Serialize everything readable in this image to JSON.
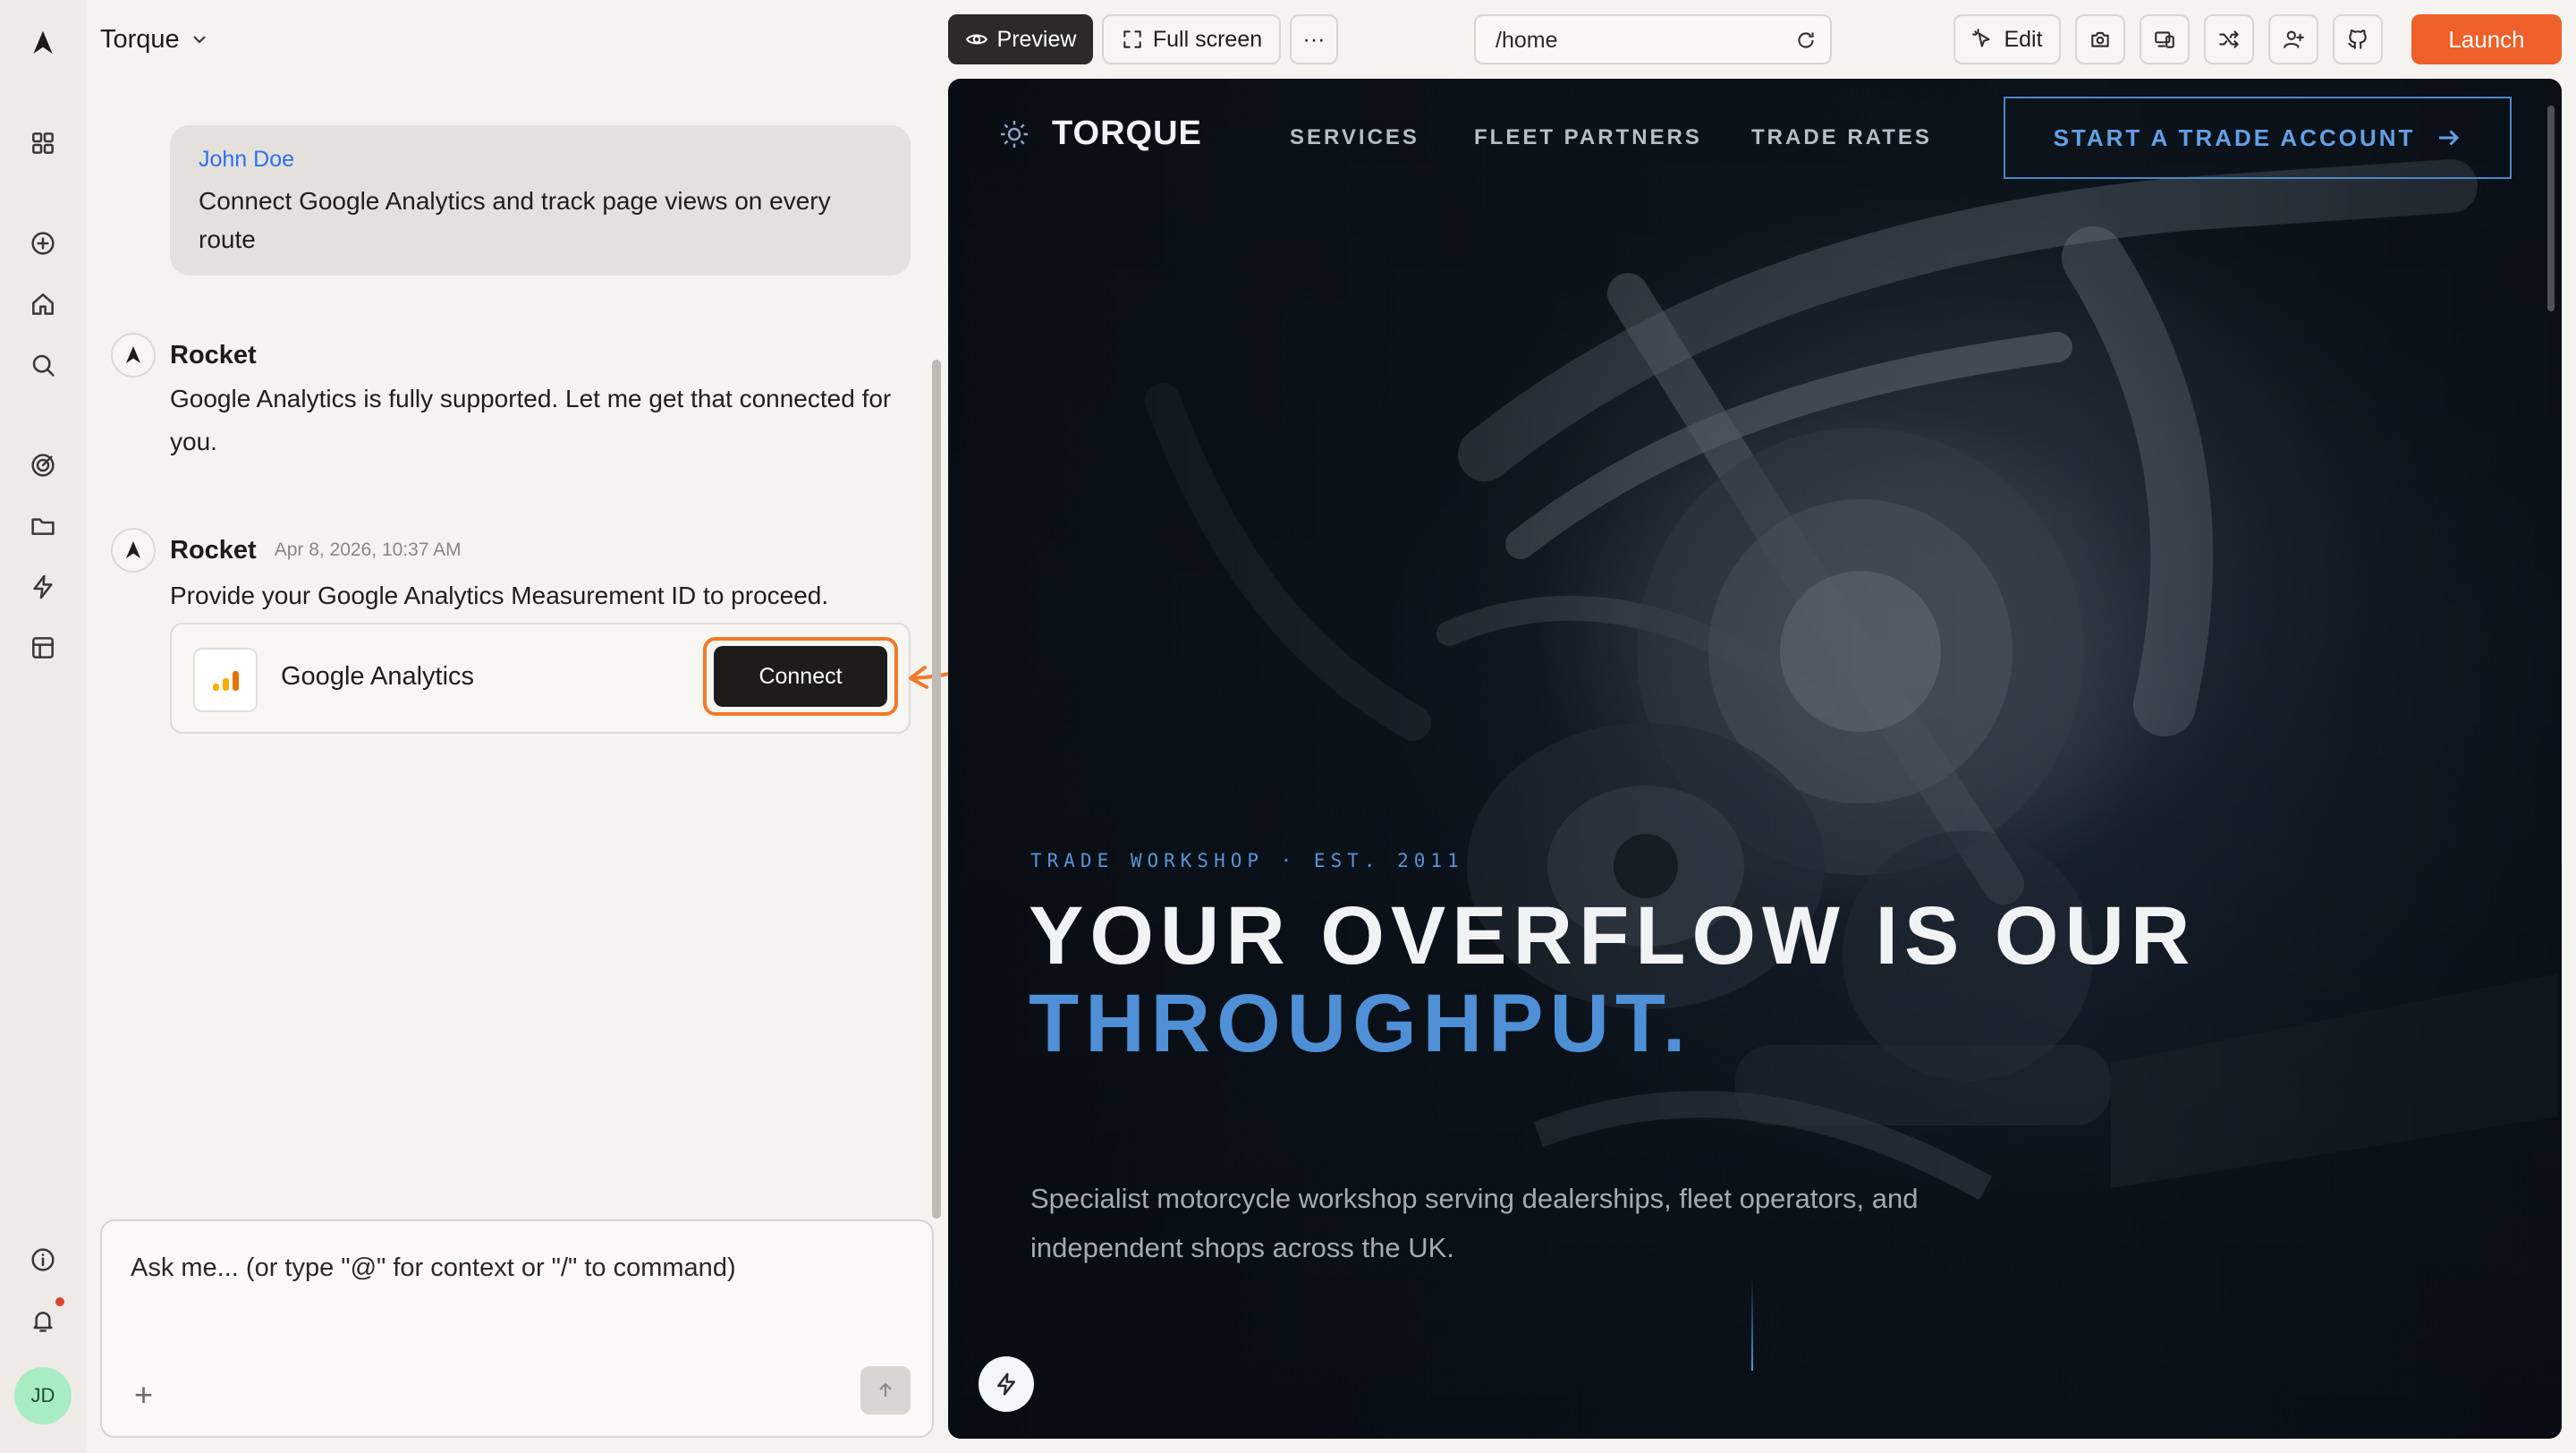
{
  "app": {
    "project_name": "Torque"
  },
  "rail": {
    "avatar_initials": "JD"
  },
  "chat": {
    "user_message": {
      "author": "John Doe",
      "text": "Connect Google Analytics and track page views on every route"
    },
    "bot_messages": [
      {
        "author": "Rocket",
        "timestamp": "",
        "text": "Google Analytics is fully supported. Let me get that connected for you."
      },
      {
        "author": "Rocket",
        "timestamp": "Apr 8, 2026, 10:37 AM",
        "text": "Provide your Google Analytics Measurement ID to proceed."
      }
    ],
    "integration_card": {
      "name": "Google Analytics",
      "button_label": "Connect"
    },
    "composer": {
      "placeholder": "Ask me... (or type \"@\" for context or \"/\" to command)",
      "add_label": "+"
    }
  },
  "toolbar": {
    "preview_label": "Preview",
    "fullscreen_label": "Full screen",
    "more_label": "···",
    "url": "/home",
    "edit_label": "Edit",
    "launch_label": "Launch"
  },
  "site": {
    "brand": "TORQUE",
    "nav": [
      "SERVICES",
      "FLEET PARTNERS",
      "TRADE RATES"
    ],
    "cta": "START A TRADE ACCOUNT",
    "eyebrow": "TRADE WORKSHOP · EST. 2011",
    "headline_line1": "YOUR OVERFLOW IS OUR",
    "headline_line2": "THROUGHPUT.",
    "subtext": "Specialist motorcycle workshop serving dealerships, fleet operators, and independent shops across the UK."
  },
  "colors": {
    "accent_orange": "#ef5f2a",
    "connect_highlight": "#f07a26",
    "site_blue": "#4f8fd6",
    "user_name_blue": "#2d6ff2"
  }
}
